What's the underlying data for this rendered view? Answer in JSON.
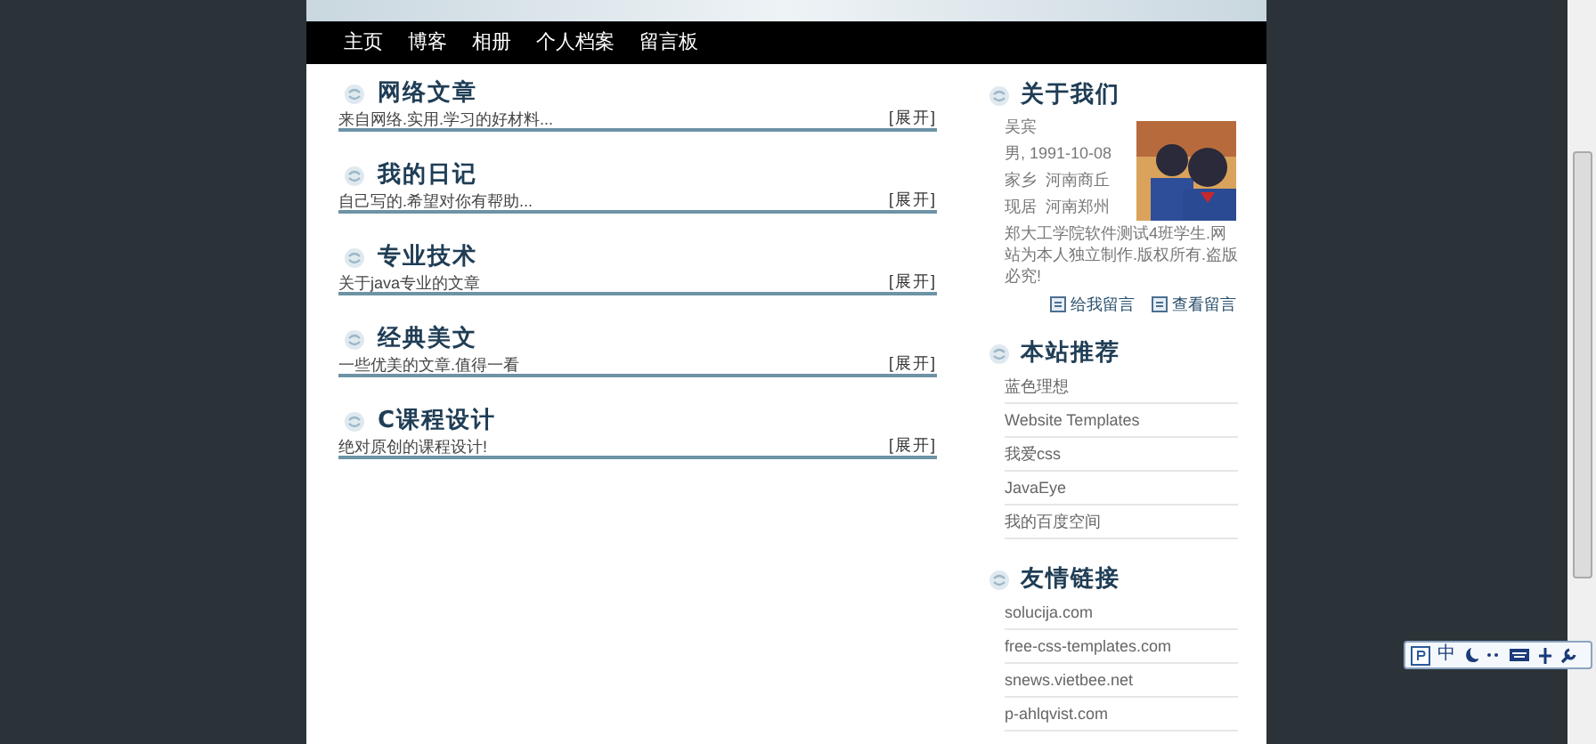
{
  "nav": [
    "主页",
    "博客",
    "相册",
    "个人档案",
    "留言板"
  ],
  "sections": [
    {
      "title": "网络文章",
      "description": "来自网络.实用.学习的好材料...",
      "toggle": "[展开]"
    },
    {
      "title": "我的日记",
      "description": "自己写的.希望对你有帮助...",
      "toggle": "[展开]"
    },
    {
      "title": "专业技术",
      "description": "关于java专业的文章",
      "toggle": "[展开]"
    },
    {
      "title": "经典美文",
      "description": "一些优美的文章.值得一看",
      "toggle": "[展开]"
    },
    {
      "title": "C课程设计",
      "description": "绝对原创的课程设计!",
      "toggle": "[展开]"
    }
  ],
  "about": {
    "title": "关于我们",
    "name": "吴宾",
    "info": [
      "男, 1991-10-08",
      "家乡  河南商丘",
      "现居  河南郑州"
    ],
    "bio": "郑大工学院软件测试4班学生.网站为本人独立制作.版权所有.盗版必究!",
    "buttons": [
      "给我留言",
      "查看留言"
    ]
  },
  "recommend": {
    "title": "本站推荐",
    "links": [
      "蓝色理想",
      "Website Templates",
      "我爱css",
      "JavaEye",
      "我的百度空间"
    ]
  },
  "friends": {
    "title": "友情链接",
    "links": [
      "solucija.com",
      "free-css-templates.com",
      "snews.vietbee.net",
      "p-ahlqvist.com"
    ]
  },
  "ime": {
    "mode": "中"
  }
}
